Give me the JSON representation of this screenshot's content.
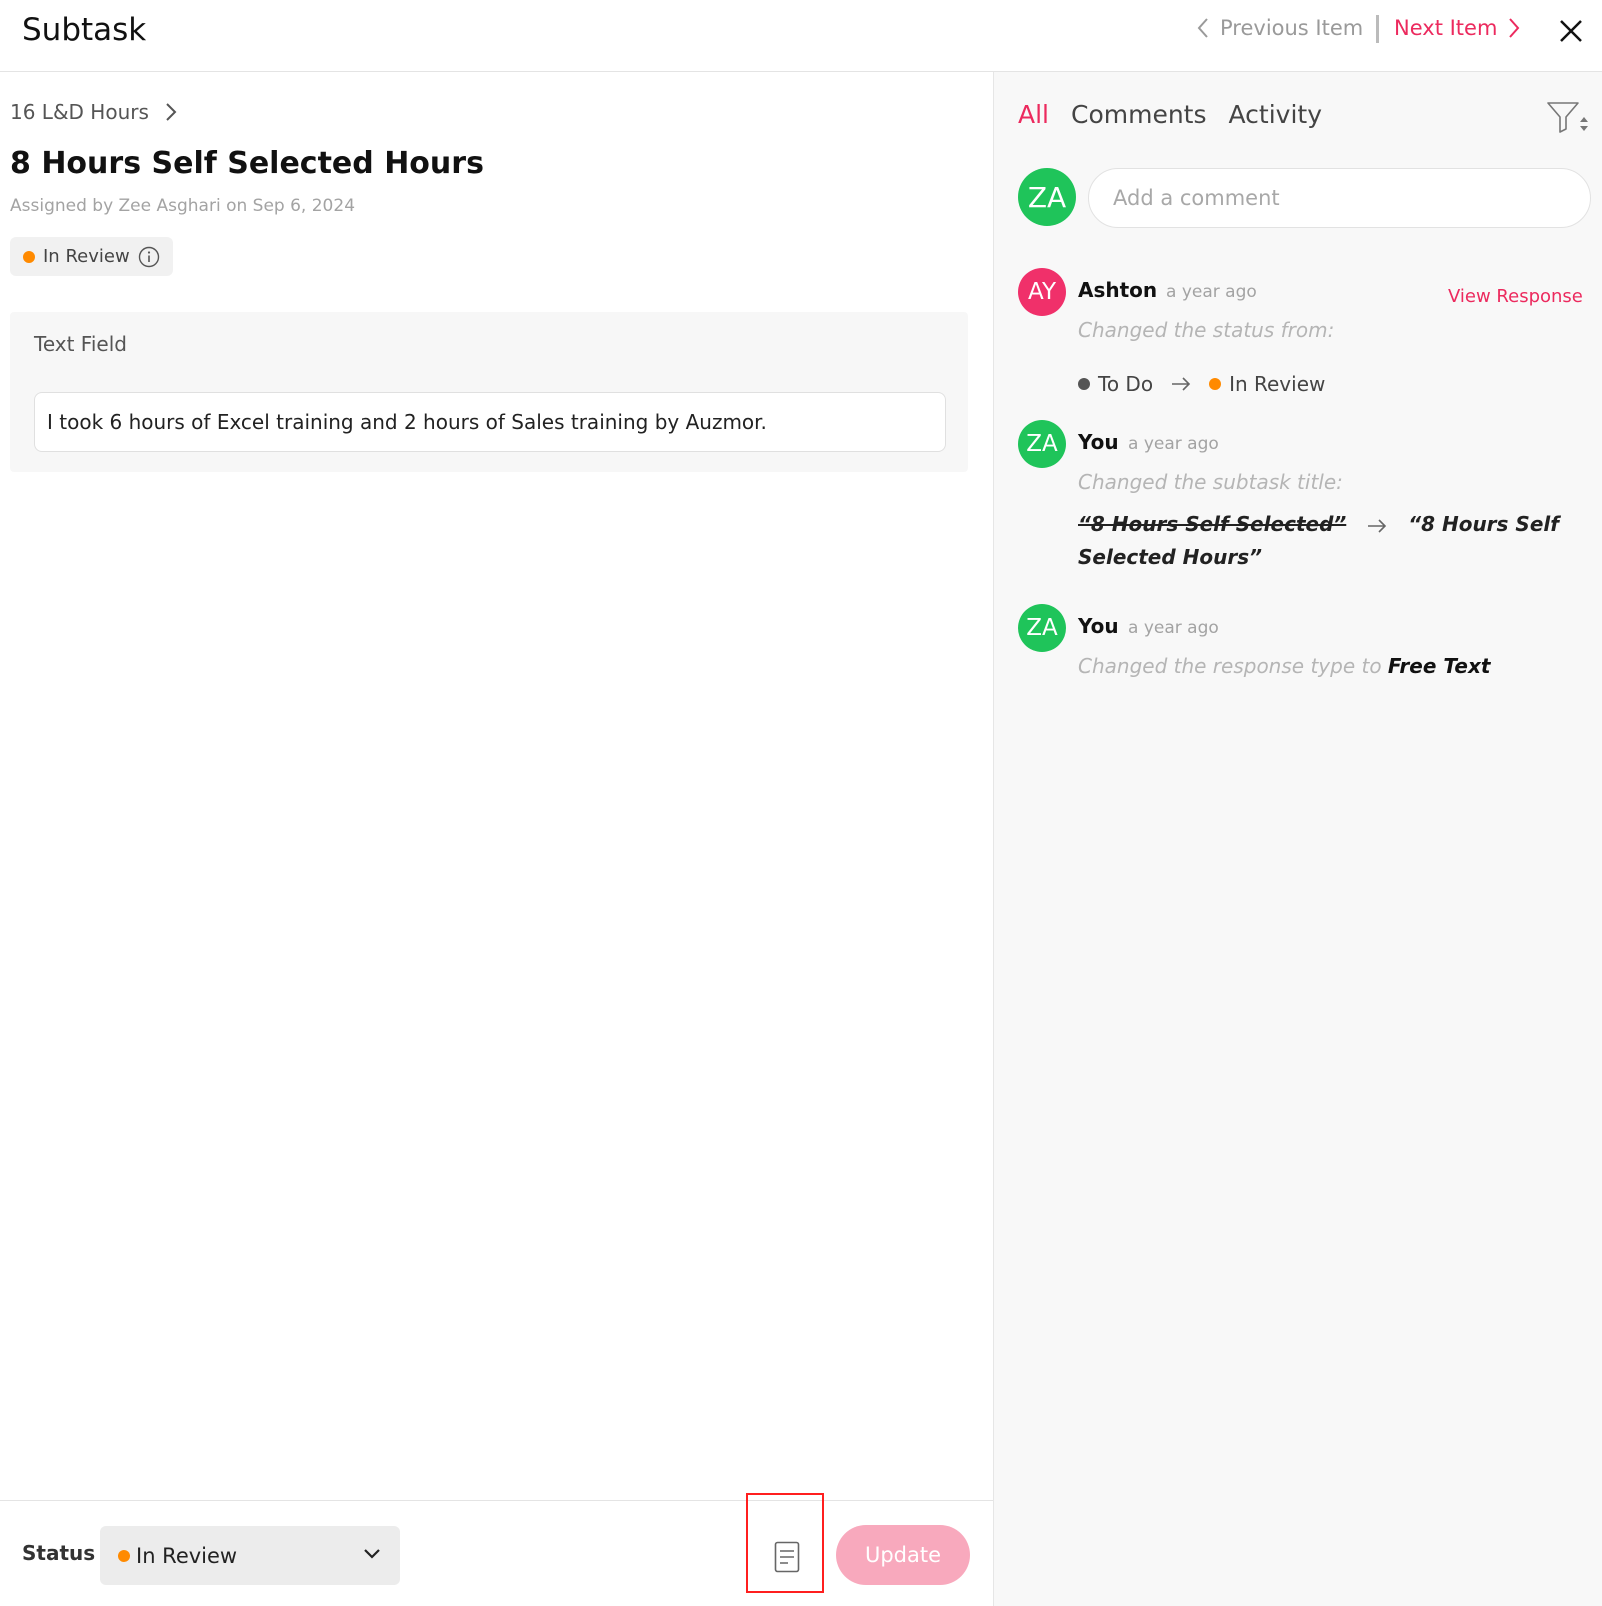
{
  "header": {
    "title": "Subtask",
    "previous_label": "Previous Item",
    "next_label": "Next Item"
  },
  "item": {
    "breadcrumb": "16 L&D Hours",
    "title": "8 Hours Self Selected Hours",
    "assigned_text": "Assigned by Zee Asghari on  Sep 6, 2024",
    "status_chip": "In Review",
    "field_label": "Text Field",
    "field_value": "I took 6 hours of Excel training and 2 hours of Sales training by Auzmor."
  },
  "footer": {
    "status_label": "Status",
    "status_value": "In Review",
    "update_label": "Update"
  },
  "activity_panel": {
    "tabs": [
      {
        "label": "All",
        "active": true
      },
      {
        "label": "Comments",
        "active": false
      },
      {
        "label": "Activity",
        "active": false
      }
    ],
    "current_user_initials": "ZA",
    "comment_placeholder": "Add a comment",
    "entries": [
      {
        "initials": "AY",
        "name": "Ashton",
        "time": "a year ago",
        "action_link": "View Response",
        "description": "Changed the status from:",
        "from_status": "To Do",
        "to_status": "In Review"
      },
      {
        "initials": "ZA",
        "name": "You",
        "time": "a year ago",
        "description": "Changed the subtask title:",
        "old_title": "“8 Hours Self Selected”",
        "new_title": "“8 Hours Self Selected Hours”"
      },
      {
        "initials": "ZA",
        "name": "You",
        "time": "a year ago",
        "description": "Changed the response type to",
        "new_value": "Free Text"
      }
    ]
  },
  "colors": {
    "accent": "#ec2a5e",
    "in_review": "#ff8a00",
    "to_do": "#555555",
    "avatar_green": "#1fc45a",
    "avatar_pink": "#f0306a",
    "update_disabled": "#f8a9bd",
    "highlight_box": "#ff1f1f"
  },
  "icons": [
    "chevron-left-icon",
    "chevron-right-icon",
    "close-icon",
    "info-icon",
    "chevron-down-icon",
    "document-icon",
    "filter-icon",
    "arrow-right-icon"
  ]
}
